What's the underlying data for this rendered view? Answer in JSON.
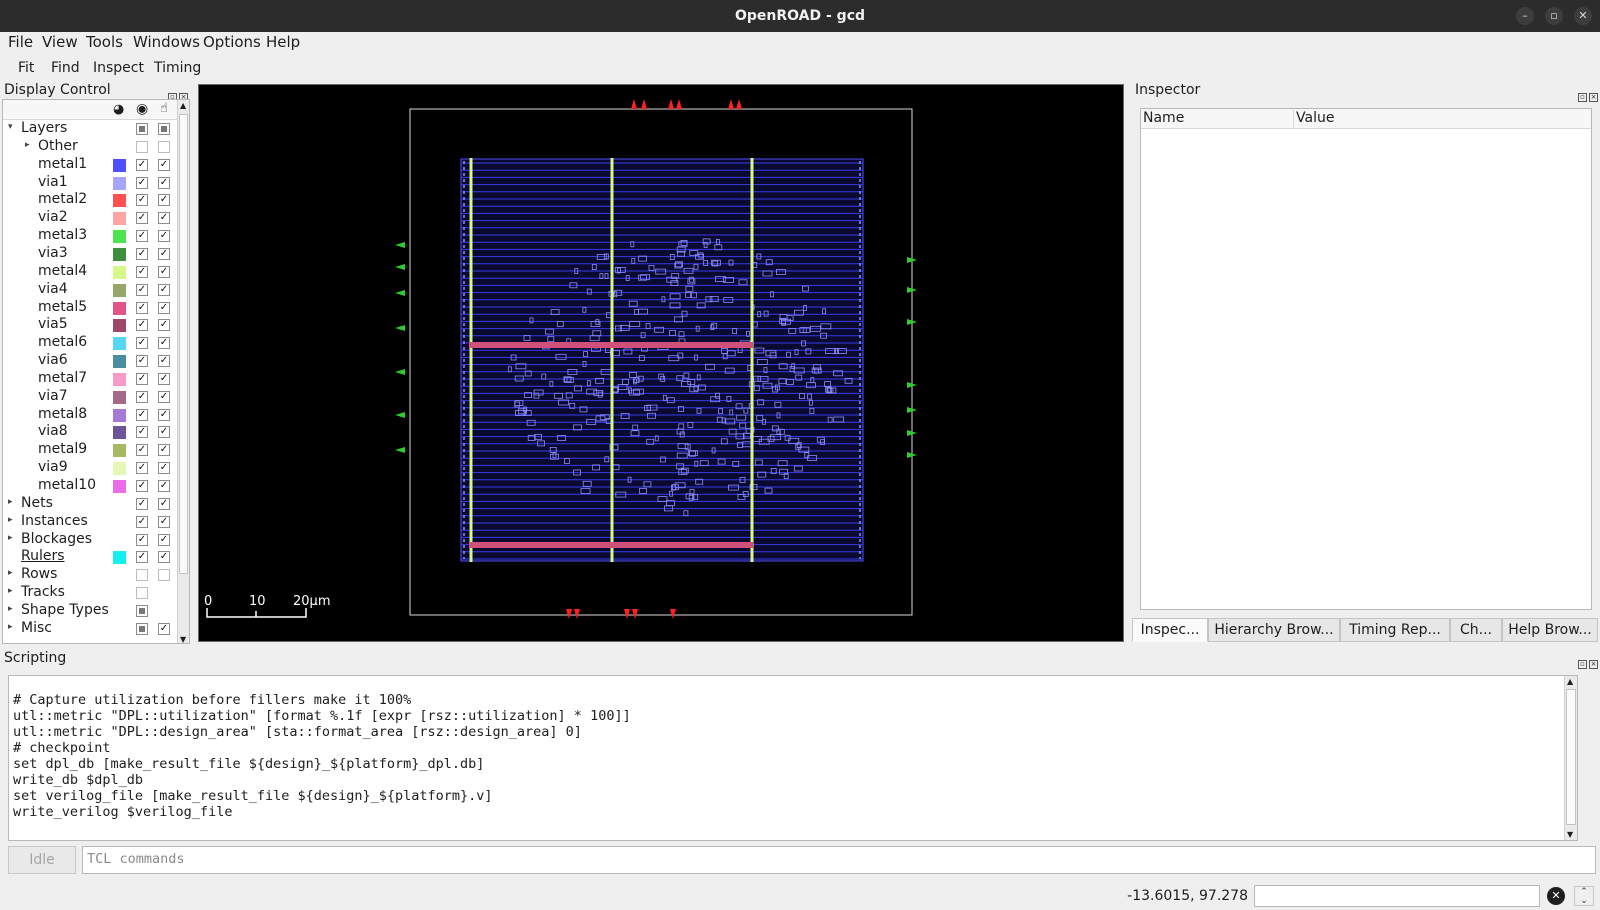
{
  "window": {
    "title": "OpenROAD - gcd"
  },
  "menu": [
    "File",
    "View",
    "Tools",
    "Windows",
    "Options",
    "Help"
  ],
  "toolbar": [
    "Fit",
    "Find",
    "Inspect",
    "Timing"
  ],
  "display_control": {
    "title": "Display Control",
    "layers_label": "Layers",
    "layers": [
      {
        "name": "Other",
        "color": "",
        "expand": true,
        "vis": false,
        "sel": false
      },
      {
        "name": "metal1",
        "color": "#4f4fff"
      },
      {
        "name": "via1",
        "color": "#a5a5ff"
      },
      {
        "name": "metal2",
        "color": "#ff4f4f"
      },
      {
        "name": "via2",
        "color": "#ffa5a5"
      },
      {
        "name": "metal3",
        "color": "#4fe34f"
      },
      {
        "name": "via3",
        "color": "#3e8e3e"
      },
      {
        "name": "metal4",
        "color": "#d6f78a"
      },
      {
        "name": "via4",
        "color": "#97a769"
      },
      {
        "name": "metal5",
        "color": "#e25487"
      },
      {
        "name": "via5",
        "color": "#9e4769"
      },
      {
        "name": "metal6",
        "color": "#55d6f3"
      },
      {
        "name": "via6",
        "color": "#4a8da1"
      },
      {
        "name": "metal7",
        "color": "#f99bc9"
      },
      {
        "name": "via7",
        "color": "#a56886"
      },
      {
        "name": "metal8",
        "color": "#a47ad6"
      },
      {
        "name": "via8",
        "color": "#6c5496"
      },
      {
        "name": "metal9",
        "color": "#a5b862"
      },
      {
        "name": "via9",
        "color": "#e6f7b5"
      },
      {
        "name": "metal10",
        "color": "#ea6ce6"
      }
    ],
    "groups": [
      {
        "name": "Nets",
        "color": "",
        "vis": true,
        "sel": true
      },
      {
        "name": "Instances",
        "color": "",
        "vis": true,
        "sel": true
      },
      {
        "name": "Blockages",
        "color": "",
        "vis": true,
        "sel": true
      },
      {
        "name": "Rulers",
        "color": "#14f0f0",
        "vis": true,
        "sel": true,
        "noarrow": true
      },
      {
        "name": "Rows",
        "color": "",
        "vis": false,
        "sel": false
      },
      {
        "name": "Tracks",
        "color": "",
        "vis": false,
        "sel": null
      },
      {
        "name": "Shape Types",
        "color": "",
        "vis": "partial",
        "sel": null
      },
      {
        "name": "Misc",
        "color": "",
        "vis": "partial",
        "sel": true
      }
    ]
  },
  "layout": {
    "scale_labels": [
      "0",
      "10",
      "20μm"
    ]
  },
  "inspector": {
    "title": "Inspector",
    "columns": [
      "Name",
      "Value"
    ]
  },
  "tabs": [
    "Inspec...",
    "Hierarchy Brow...",
    "Timing Rep...",
    "Ch...",
    "Help Brow..."
  ],
  "scripting": {
    "title": "Scripting",
    "lines": [
      "# Capture utilization before fillers make it 100%",
      "utl::metric \"DPL::utilization\" [format %.1f [expr [rsz::utilization] * 100]]",
      "utl::metric \"DPL::design_area\" [sta::format_area [rsz::design_area] 0]",
      "# checkpoint",
      "set dpl_db [make_result_file ${design}_${platform}_dpl.db]",
      "write_db $dpl_db",
      "set verilog_file [make_result_file ${design}_${platform}.v]",
      "write_verilog $verilog_file"
    ],
    "idle_label": "Idle",
    "input_placeholder": "TCL commands"
  },
  "status": {
    "coords": "-13.6015, 97.278"
  },
  "colors": {
    "metal_rail": "#d6f78a",
    "track_blue": "#3a3ae8",
    "pin_green": "#2ecc2e",
    "pin_red": "#ff2020",
    "hstripe": "#d0507a"
  }
}
